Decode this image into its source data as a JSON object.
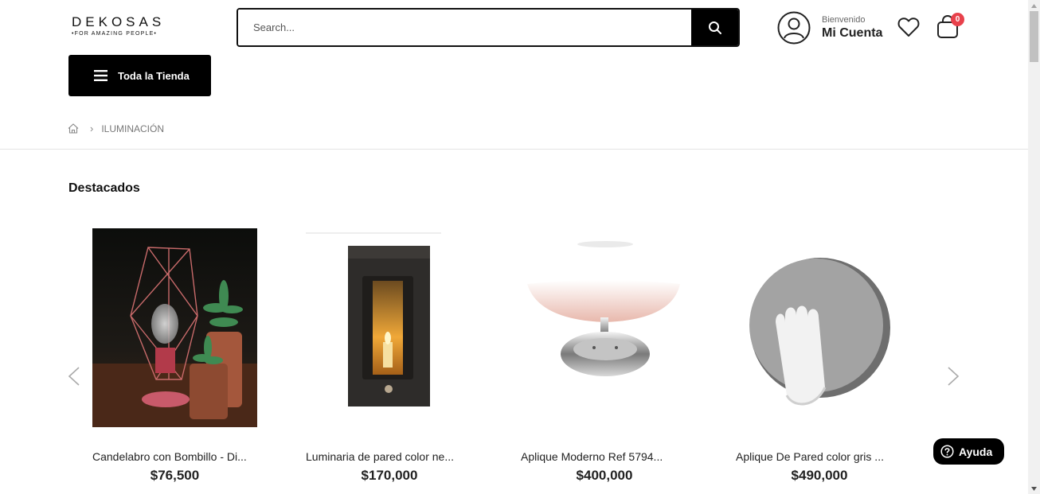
{
  "brand": {
    "name": "DEKOSAS",
    "tagline": "•FOR AMAZING PEOPLE•"
  },
  "search": {
    "placeholder": "Search...",
    "icon": "search-icon"
  },
  "account": {
    "welcome": "Bienvenido",
    "name": "Mi Cuenta",
    "icon": "user-icon"
  },
  "cart": {
    "count": "0",
    "icon": "shopping-bag-icon"
  },
  "wishlist": {
    "icon": "heart-icon"
  },
  "menu": {
    "all_store_label": "Toda la Tienda",
    "icon": "hamburger-icon"
  },
  "breadcrumb": {
    "home_icon": "home-icon",
    "current": "ILUMINACIÓN"
  },
  "section": {
    "title": "Destacados"
  },
  "products": [
    {
      "name": "Candelabro con Bombillo - Di...",
      "price": "$76,500"
    },
    {
      "name": "Luminaria de pared color ne...",
      "price": "$170,000"
    },
    {
      "name": "Aplique Moderno Ref 5794...",
      "price": "$400,000"
    },
    {
      "name": "Aplique De Pared color gris ...",
      "price": "$490,000"
    }
  ],
  "help": {
    "label": "Ayuda",
    "icon": "question-icon"
  },
  "colors": {
    "accent": "#000000",
    "badge": "#e8414b",
    "text": "#222222"
  }
}
